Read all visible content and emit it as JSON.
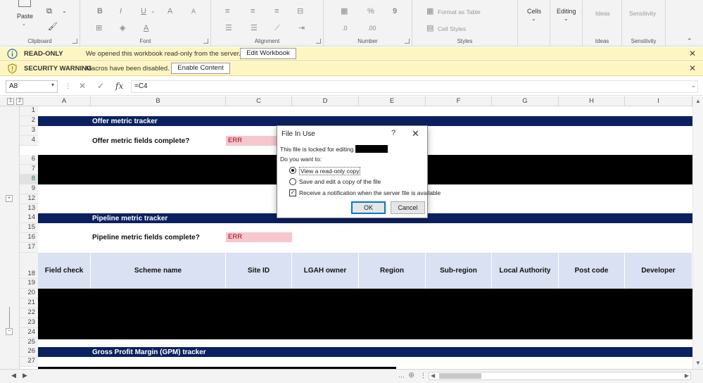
{
  "ribbon": {
    "paste_label": "Paste",
    "groups": {
      "clipboard": "Clipboard",
      "font": "Font",
      "alignment": "Alignment",
      "number": "Number",
      "styles": "Styles",
      "ideas": "Ideas",
      "sensitivity": "Sensitivity"
    },
    "format_as_table": "Format as Table",
    "cell_styles": "Cell Styles",
    "cells": "Cells",
    "editing": "Editing",
    "ideas_btn": "Ideas",
    "sensitivity_btn": "Sensitivity",
    "percent_symbol": "%",
    "comma_symbol": "9"
  },
  "readonly_bar": {
    "title": "READ-ONLY",
    "message": "We opened this workbook read-only from the server.",
    "button": "Edit Workbook"
  },
  "security_bar": {
    "title": "SECURITY WARNING",
    "message": "Macros have been disabled.",
    "button": "Enable Content"
  },
  "formula_bar": {
    "name_box": "A8",
    "formula": "=C4",
    "fx": "fx"
  },
  "outline_levels": [
    "1",
    "2"
  ],
  "columns": [
    "A",
    "B",
    "C",
    "D",
    "E",
    "F",
    "G",
    "H",
    "I"
  ],
  "rows": [
    "1",
    "2",
    "3",
    "4",
    "6",
    "7",
    "8",
    "9",
    "12",
    "13",
    "14",
    "15",
    "16",
    "17",
    "18",
    "19",
    "20",
    "21",
    "22",
    "23",
    "24",
    "25",
    "26",
    "27"
  ],
  "sheet": {
    "offer_title": "Offer metric tracker",
    "offer_label": "Offer metric fields complete?",
    "offer_value": "ERR",
    "pipeline_title": "Pipeline metric tracker",
    "pipeline_label": "Pipeline metric fields complete?",
    "pipeline_value": "ERR",
    "table_headers": [
      "Field check",
      "Scheme name",
      "Site ID",
      "LGAH owner",
      "Region",
      "Sub-region",
      "Local Authority",
      "Post code",
      "Developer"
    ],
    "gpm_title": "Gross Profit Margin (GPM) tracker"
  },
  "dialog": {
    "title": "File In Use",
    "help": "?",
    "locked_text": "This file is locked for editing by",
    "prompt": "Do you want to:",
    "option_readonly": "View a read-only copy",
    "option_copy": "Save and edit a copy of the file",
    "option_notify": "Receive a notification when the server file is available",
    "ok": "OK",
    "cancel": "Cancel"
  },
  "colors": {
    "navy_band": "#0b2060",
    "header_fill": "#d9e1f2",
    "err_fill": "#f7c6ce",
    "err_text": "#9c0006",
    "message_bar": "#fdf6c3"
  }
}
